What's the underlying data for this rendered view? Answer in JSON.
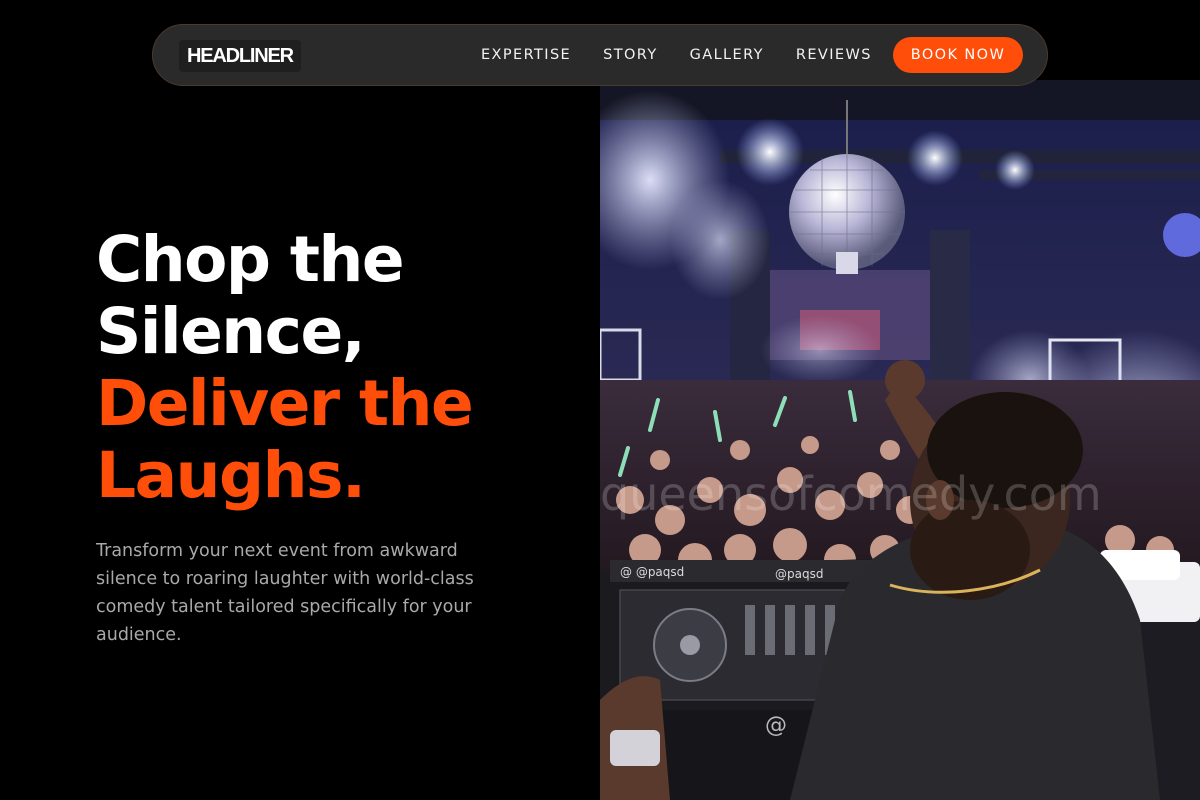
{
  "nav": {
    "logo": "HEADLINER",
    "links": [
      "EXPERTISE",
      "STORY",
      "GALLERY",
      "REVIEWS"
    ],
    "cta": "BOOK NOW"
  },
  "hero": {
    "headline_lines": [
      "Chop the",
      "Silence,",
      "Deliver the",
      "Laughs."
    ],
    "subtitle": "Transform your next event from awkward silence to roaring laughter with world-class comedy talent tailored specifically for your audience.",
    "watermark": "queensofcomedy.com",
    "image": "dj-performing-in-nightclub-crowd"
  },
  "colors": {
    "background": "#000000",
    "accent": "#ff4d0a",
    "nav_bg": "#2a2a2a",
    "subtitle_text": "#a9a9a9"
  }
}
